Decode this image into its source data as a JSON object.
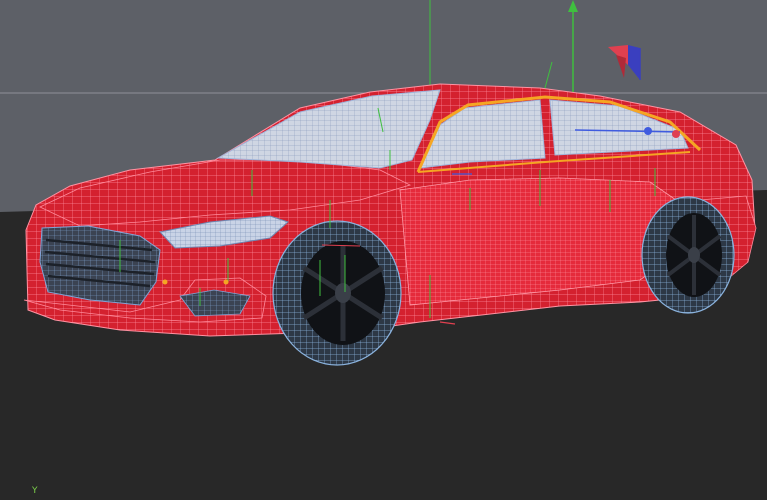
{
  "viewport": {
    "axis_indicator": "Y",
    "background_top": "#5d6067",
    "ground": "#282828",
    "horizon_line": "#8e9198"
  },
  "model": {
    "body_color": "#e3283a",
    "wire_color_body": "#ff7f90",
    "wire_color_glass": "#8aa6d8",
    "tire_color": "#101216",
    "selection_color": "#f5a623",
    "helper_color": "#3fbf3f"
  },
  "icons": {
    "scene_axis": "move-gizmo-y-icon",
    "view_cube": "view-cube-icon",
    "light_gizmo": "light-helper-icon"
  }
}
